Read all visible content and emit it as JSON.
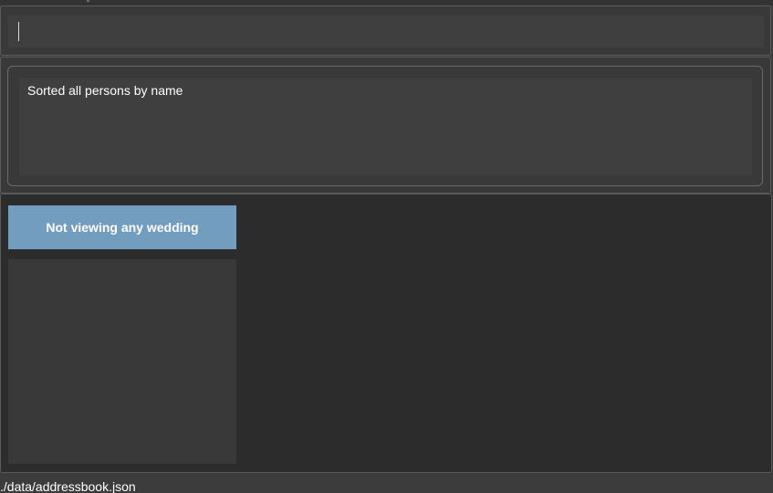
{
  "command_box": {
    "value": "",
    "placeholder": ""
  },
  "result_display": {
    "message": "Sorted all persons by name"
  },
  "wedding_panel": {
    "header": "Not viewing any wedding",
    "items": []
  },
  "status_bar": {
    "file_path": "./data/addressbook.json"
  },
  "colors": {
    "background": "#3c3c3c",
    "panel": "#393939",
    "input": "#3f3f3f",
    "main_panel": "#2c2c2c",
    "accent": "#729dbf",
    "text": "#ffffff"
  }
}
